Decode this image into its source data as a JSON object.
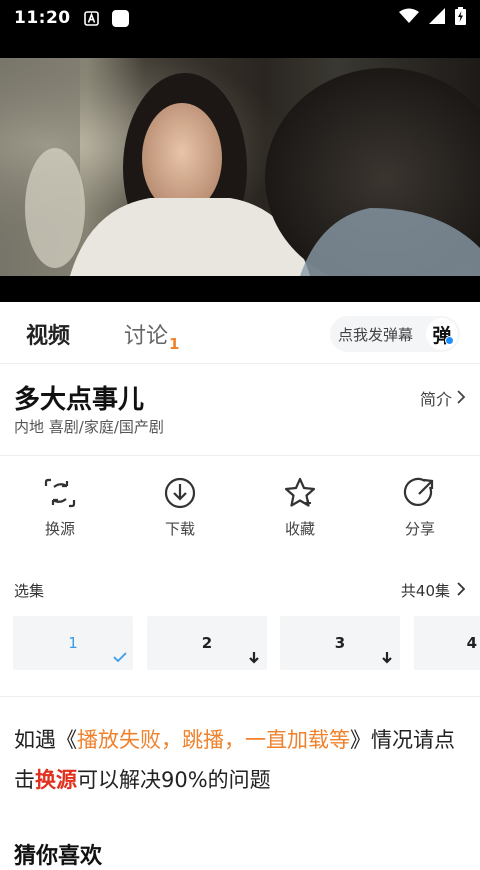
{
  "status_bar": {
    "time": "11:20"
  },
  "tabs": [
    {
      "label": "视频"
    },
    {
      "label": "讨论",
      "badge": "1"
    }
  ],
  "danmu_button": {
    "label": "点我发弹幕",
    "icon_text": "弹"
  },
  "show": {
    "title": "多大点事儿",
    "intro_label": "简介",
    "tags": "内地 喜剧/家庭/国产剧"
  },
  "actions": [
    {
      "label": "换源",
      "icon": "switch-source-icon"
    },
    {
      "label": "下载",
      "icon": "download-icon"
    },
    {
      "label": "收藏",
      "icon": "star-icon"
    },
    {
      "label": "分享",
      "icon": "share-icon"
    }
  ],
  "episodes": {
    "header": "选集",
    "count_label": "共40集",
    "items": [
      {
        "label": "1",
        "state": "selected"
      },
      {
        "label": "2",
        "state": "download"
      },
      {
        "label": "3",
        "state": "download"
      },
      {
        "label": "4",
        "state": ""
      }
    ]
  },
  "notice": {
    "p1": "如遇《",
    "p2": "播放失败，跳播，一直加载等",
    "p3": "》情况请点击",
    "p4": "换源",
    "p5": "可以解决90%的问题"
  },
  "guess_title": "猜你喜欢",
  "colors": {
    "accent_orange": "#f0822d",
    "accent_red": "#e0301e",
    "accent_blue": "#3a9be8"
  }
}
